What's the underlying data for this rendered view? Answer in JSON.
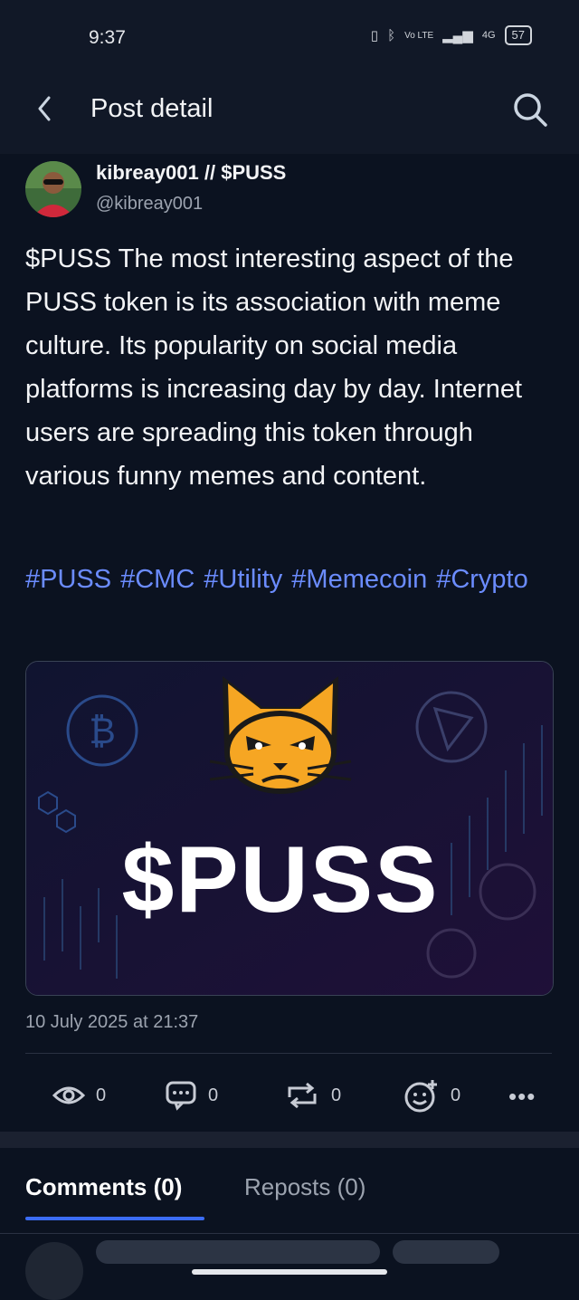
{
  "status_bar": {
    "time": "9:37",
    "network": "4G",
    "volte": "Vo LTE",
    "battery": "57"
  },
  "header": {
    "title": "Post detail",
    "back_icon": "chevron-left-icon",
    "search_icon": "search-icon"
  },
  "post": {
    "author_name": "kibreay001 // $PUSS",
    "author_handle": "@kibreay001",
    "text": "$PUSS The most interesting aspect of the PUSS token is its association with meme culture. Its popularity on social media platforms is increasing day by day. Internet users are spreading this token through various funny memes and content.",
    "hashtags": [
      "#PUSS",
      "#CMC",
      "#Utility",
      "#Memecoin",
      "#Crypto"
    ],
    "image_text": "$PUSS",
    "date": "10 July 2025 at 21:37",
    "stats": {
      "views": "0",
      "comments": "0",
      "reposts": "0",
      "reactions": "0"
    },
    "more_label": "•••"
  },
  "tabs": {
    "comments": "Comments (0)",
    "reposts": "Reposts (0)"
  },
  "colors": {
    "background": "#0b1220",
    "accent": "#3b6cf6",
    "hashtag": "#6b8cff",
    "logo_orange": "#f6a623"
  }
}
